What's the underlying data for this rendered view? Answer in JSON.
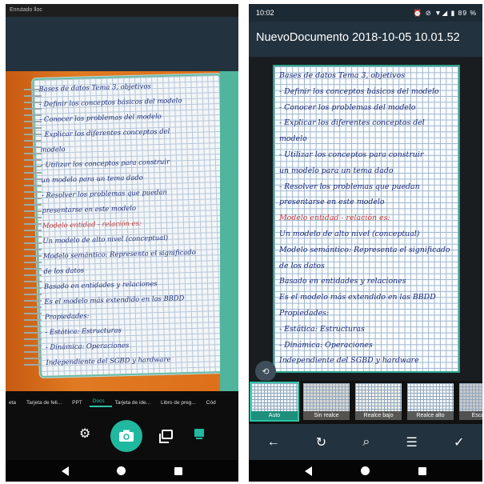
{
  "left": {
    "status": {
      "carrier": "Enrutado lloc"
    },
    "notebook_lines": [
      "Bases de datos   Tema 3, objetivos",
      "- Definir los conceptos básicos del modelo",
      "- Conocer los problemas del modelo",
      "- Explicar los diferentes conceptos del",
      "  modelo",
      "- Utilizar los conceptos para construir",
      "  un modelo para un tema dado",
      "- Resolver los problemas que puedan",
      "  presentarse en este modelo",
      "Modelo entidad - relación es:",
      "Un modelo de alto nivel (conceptual)",
      "Modelo semántico: Representa el significado",
      "  de los datos",
      "Basado en entidades y relaciones",
      "Es el modelo más extendido en las BBDD",
      "Propiedades:",
      "  - Estática: Estructuras",
      "  - Dinámica: Operaciones",
      "Independiente del SGBD y hardware"
    ],
    "modes": [
      "eta",
      "Tarjeta de feli...",
      "PPT",
      "Docs",
      "Tarjeta de ide...",
      "Libro de preg...",
      "Cód"
    ],
    "active_mode": "Docs",
    "icons": {
      "settings": "gear-icon",
      "shutter": "camera-icon",
      "gallery": "gallery-icon",
      "docs": "document-icon"
    }
  },
  "right": {
    "status": {
      "time": "10:02",
      "icons": "⏰ ⊘ ▼◢ ▮ 89 %"
    },
    "title": "NuevoDocumento 2018-10-05 10.01.52",
    "filters": [
      {
        "label": "Auto",
        "active": true
      },
      {
        "label": "Sin realce",
        "active": false
      },
      {
        "label": "Realce bajo",
        "active": false
      },
      {
        "label": "Realce alto",
        "active": false
      },
      {
        "label": "Escala d",
        "active": false
      }
    ],
    "toolbar": {
      "back": "←",
      "rotate": "↻",
      "ocr": "⌕",
      "adjust": "☰",
      "confirm": "✓"
    }
  }
}
